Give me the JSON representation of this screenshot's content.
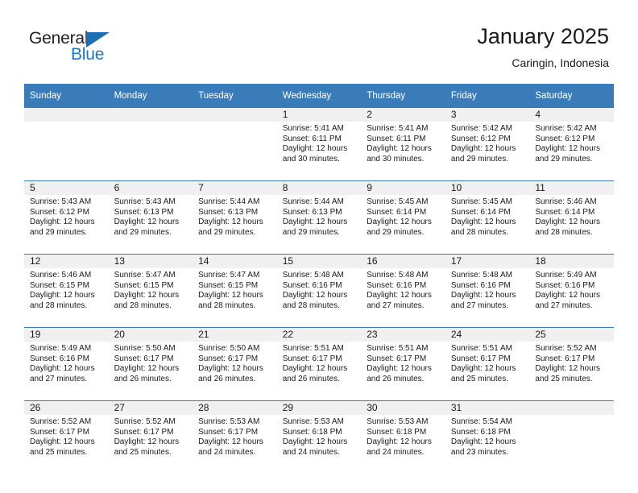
{
  "brand": {
    "name_top": "General",
    "name_bottom": "Blue",
    "triangle_color": "#1c6fb5",
    "text_color_top": "#231f20",
    "text_color_bottom": "#1f77c2"
  },
  "header": {
    "title": "January 2025",
    "subtitle": "Caringin, Indonesia"
  },
  "theme": {
    "header_row_bg": "#3a7cba",
    "header_row_text": "#ffffff",
    "daynum_band_bg": "#f0f0f0",
    "row_divider": "#3a7cba",
    "cell_bg": "#ffffff",
    "body_text": "#1a1a1a"
  },
  "weekday_headers": [
    "Sunday",
    "Monday",
    "Tuesday",
    "Wednesday",
    "Thursday",
    "Friday",
    "Saturday"
  ],
  "weeks": [
    [
      {
        "day": "",
        "lines": []
      },
      {
        "day": "",
        "lines": []
      },
      {
        "day": "",
        "lines": []
      },
      {
        "day": "1",
        "lines": [
          "Sunrise: 5:41 AM",
          "Sunset: 6:11 PM",
          "Daylight: 12 hours",
          "and 30 minutes."
        ]
      },
      {
        "day": "2",
        "lines": [
          "Sunrise: 5:41 AM",
          "Sunset: 6:11 PM",
          "Daylight: 12 hours",
          "and 30 minutes."
        ]
      },
      {
        "day": "3",
        "lines": [
          "Sunrise: 5:42 AM",
          "Sunset: 6:12 PM",
          "Daylight: 12 hours",
          "and 29 minutes."
        ]
      },
      {
        "day": "4",
        "lines": [
          "Sunrise: 5:42 AM",
          "Sunset: 6:12 PM",
          "Daylight: 12 hours",
          "and 29 minutes."
        ]
      }
    ],
    [
      {
        "day": "5",
        "lines": [
          "Sunrise: 5:43 AM",
          "Sunset: 6:12 PM",
          "Daylight: 12 hours",
          "and 29 minutes."
        ]
      },
      {
        "day": "6",
        "lines": [
          "Sunrise: 5:43 AM",
          "Sunset: 6:13 PM",
          "Daylight: 12 hours",
          "and 29 minutes."
        ]
      },
      {
        "day": "7",
        "lines": [
          "Sunrise: 5:44 AM",
          "Sunset: 6:13 PM",
          "Daylight: 12 hours",
          "and 29 minutes."
        ]
      },
      {
        "day": "8",
        "lines": [
          "Sunrise: 5:44 AM",
          "Sunset: 6:13 PM",
          "Daylight: 12 hours",
          "and 29 minutes."
        ]
      },
      {
        "day": "9",
        "lines": [
          "Sunrise: 5:45 AM",
          "Sunset: 6:14 PM",
          "Daylight: 12 hours",
          "and 29 minutes."
        ]
      },
      {
        "day": "10",
        "lines": [
          "Sunrise: 5:45 AM",
          "Sunset: 6:14 PM",
          "Daylight: 12 hours",
          "and 28 minutes."
        ]
      },
      {
        "day": "11",
        "lines": [
          "Sunrise: 5:46 AM",
          "Sunset: 6:14 PM",
          "Daylight: 12 hours",
          "and 28 minutes."
        ]
      }
    ],
    [
      {
        "day": "12",
        "lines": [
          "Sunrise: 5:46 AM",
          "Sunset: 6:15 PM",
          "Daylight: 12 hours",
          "and 28 minutes."
        ]
      },
      {
        "day": "13",
        "lines": [
          "Sunrise: 5:47 AM",
          "Sunset: 6:15 PM",
          "Daylight: 12 hours",
          "and 28 minutes."
        ]
      },
      {
        "day": "14",
        "lines": [
          "Sunrise: 5:47 AM",
          "Sunset: 6:15 PM",
          "Daylight: 12 hours",
          "and 28 minutes."
        ]
      },
      {
        "day": "15",
        "lines": [
          "Sunrise: 5:48 AM",
          "Sunset: 6:16 PM",
          "Daylight: 12 hours",
          "and 28 minutes."
        ]
      },
      {
        "day": "16",
        "lines": [
          "Sunrise: 5:48 AM",
          "Sunset: 6:16 PM",
          "Daylight: 12 hours",
          "and 27 minutes."
        ]
      },
      {
        "day": "17",
        "lines": [
          "Sunrise: 5:48 AM",
          "Sunset: 6:16 PM",
          "Daylight: 12 hours",
          "and 27 minutes."
        ]
      },
      {
        "day": "18",
        "lines": [
          "Sunrise: 5:49 AM",
          "Sunset: 6:16 PM",
          "Daylight: 12 hours",
          "and 27 minutes."
        ]
      }
    ],
    [
      {
        "day": "19",
        "lines": [
          "Sunrise: 5:49 AM",
          "Sunset: 6:16 PM",
          "Daylight: 12 hours",
          "and 27 minutes."
        ]
      },
      {
        "day": "20",
        "lines": [
          "Sunrise: 5:50 AM",
          "Sunset: 6:17 PM",
          "Daylight: 12 hours",
          "and 26 minutes."
        ]
      },
      {
        "day": "21",
        "lines": [
          "Sunrise: 5:50 AM",
          "Sunset: 6:17 PM",
          "Daylight: 12 hours",
          "and 26 minutes."
        ]
      },
      {
        "day": "22",
        "lines": [
          "Sunrise: 5:51 AM",
          "Sunset: 6:17 PM",
          "Daylight: 12 hours",
          "and 26 minutes."
        ]
      },
      {
        "day": "23",
        "lines": [
          "Sunrise: 5:51 AM",
          "Sunset: 6:17 PM",
          "Daylight: 12 hours",
          "and 26 minutes."
        ]
      },
      {
        "day": "24",
        "lines": [
          "Sunrise: 5:51 AM",
          "Sunset: 6:17 PM",
          "Daylight: 12 hours",
          "and 25 minutes."
        ]
      },
      {
        "day": "25",
        "lines": [
          "Sunrise: 5:52 AM",
          "Sunset: 6:17 PM",
          "Daylight: 12 hours",
          "and 25 minutes."
        ]
      }
    ],
    [
      {
        "day": "26",
        "lines": [
          "Sunrise: 5:52 AM",
          "Sunset: 6:17 PM",
          "Daylight: 12 hours",
          "and 25 minutes."
        ]
      },
      {
        "day": "27",
        "lines": [
          "Sunrise: 5:52 AM",
          "Sunset: 6:17 PM",
          "Daylight: 12 hours",
          "and 25 minutes."
        ]
      },
      {
        "day": "28",
        "lines": [
          "Sunrise: 5:53 AM",
          "Sunset: 6:17 PM",
          "Daylight: 12 hours",
          "and 24 minutes."
        ]
      },
      {
        "day": "29",
        "lines": [
          "Sunrise: 5:53 AM",
          "Sunset: 6:18 PM",
          "Daylight: 12 hours",
          "and 24 minutes."
        ]
      },
      {
        "day": "30",
        "lines": [
          "Sunrise: 5:53 AM",
          "Sunset: 6:18 PM",
          "Daylight: 12 hours",
          "and 24 minutes."
        ]
      },
      {
        "day": "31",
        "lines": [
          "Sunrise: 5:54 AM",
          "Sunset: 6:18 PM",
          "Daylight: 12 hours",
          "and 23 minutes."
        ]
      },
      {
        "day": "",
        "lines": []
      }
    ]
  ]
}
